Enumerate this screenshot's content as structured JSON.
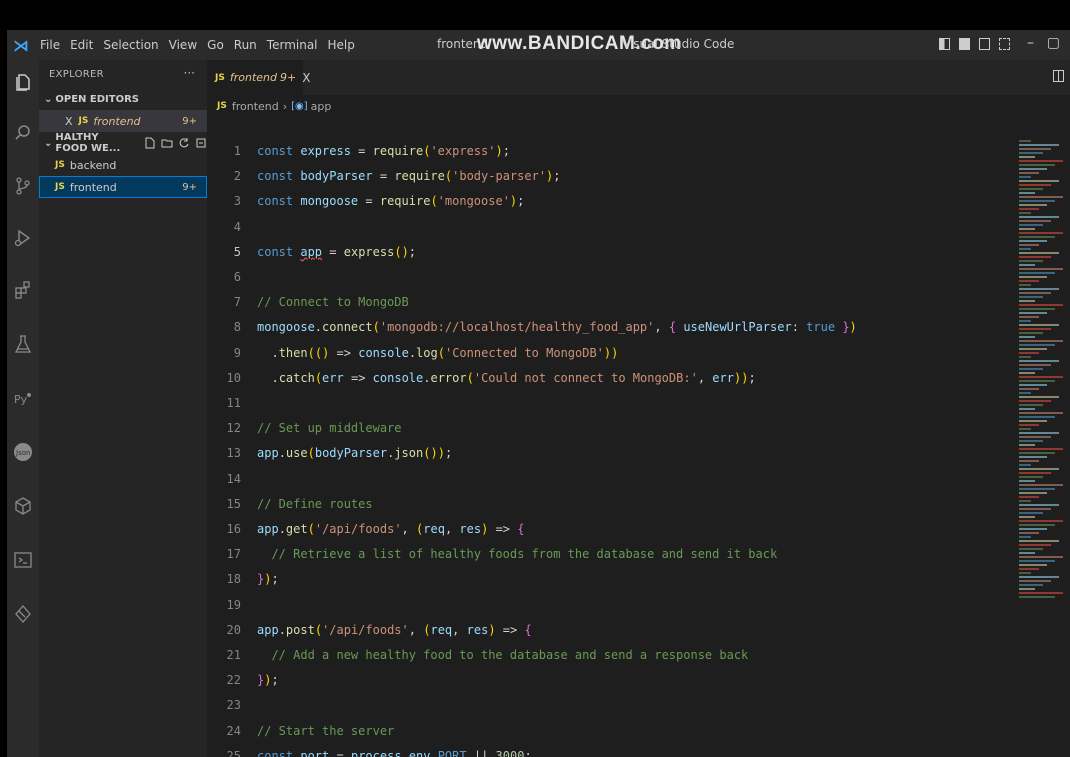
{
  "window": {
    "title_left": "frontend",
    "title_right": "Visual Studio Code",
    "watermark": "www.BANDICAM.com"
  },
  "menu": [
    "File",
    "Edit",
    "Selection",
    "View",
    "Go",
    "Run",
    "Terminal",
    "Help"
  ],
  "window_controls": {
    "minimize": "–",
    "restore": "▢"
  },
  "explorer": {
    "header": "EXPLORER",
    "more": "···",
    "open_editors_label": "OPEN EDITORS",
    "open_editor_close": "X",
    "open_editor_file": "frontend",
    "open_editor_badge": "9+",
    "folder_label": "HALTHY FOOD WE...",
    "files": [
      {
        "name": "backend",
        "badge": ""
      },
      {
        "name": "frontend",
        "badge": "9+"
      }
    ]
  },
  "tab": {
    "title": "frontend",
    "badge": "9+",
    "close": "X",
    "file_badge": "JS"
  },
  "breadcrumb": {
    "file": "frontend",
    "symbol": "app"
  },
  "code_lines": [
    {
      "n": "1",
      "t": "const express = require('express');"
    },
    {
      "n": "2",
      "t": "const bodyParser = require('body-parser');"
    },
    {
      "n": "3",
      "t": "const mongoose = require('mongoose');"
    },
    {
      "n": "4",
      "t": ""
    },
    {
      "n": "5",
      "t": "const app = express();"
    },
    {
      "n": "6",
      "t": ""
    },
    {
      "n": "7",
      "t": "// Connect to MongoDB"
    },
    {
      "n": "8",
      "t": "mongoose.connect('mongodb://localhost/healthy_food_app', { useNewUrlParser: true })"
    },
    {
      "n": "9",
      "t": ".then(() => console.log('Connected to MongoDB'))"
    },
    {
      "n": "10",
      "t": ".catch(err => console.error('Could not connect to MongoDB:', err));"
    },
    {
      "n": "11",
      "t": ""
    },
    {
      "n": "12",
      "t": "// Set up middleware"
    },
    {
      "n": "13",
      "t": "app.use(bodyParser.json());"
    },
    {
      "n": "14",
      "t": ""
    },
    {
      "n": "15",
      "t": "// Define routes"
    },
    {
      "n": "16",
      "t": "app.get('/api/foods', (req, res) => {"
    },
    {
      "n": "17",
      "t": "// Retrieve a list of healthy foods from the database and send it back"
    },
    {
      "n": "18",
      "t": "});"
    },
    {
      "n": "19",
      "t": ""
    },
    {
      "n": "20",
      "t": "app.post('/api/foods', (req, res) => {"
    },
    {
      "n": "21",
      "t": "// Add a new healthy food to the database and send a response back"
    },
    {
      "n": "22",
      "t": "});"
    },
    {
      "n": "23",
      "t": ""
    },
    {
      "n": "24",
      "t": "// Start the server"
    },
    {
      "n": "25",
      "t": "const port = process.env.PORT || 3000;"
    }
  ],
  "colors": {
    "editor_bg": "#1e1e1e",
    "sidebar_bg": "#252526",
    "active_item": "#04395e",
    "keyword": "#569cd6",
    "string": "#ce9178",
    "comment": "#6a9955",
    "function": "#dcdcaa",
    "variable": "#9cdcfe",
    "modified": "#e2c08d"
  },
  "icons": [
    "files-icon",
    "search-icon",
    "source-control-icon",
    "run-debug-icon",
    "extensions-icon",
    "testing-icon",
    "python-icon",
    "json-icon",
    "package-icon",
    "terminal-icon",
    "remote-icon"
  ]
}
